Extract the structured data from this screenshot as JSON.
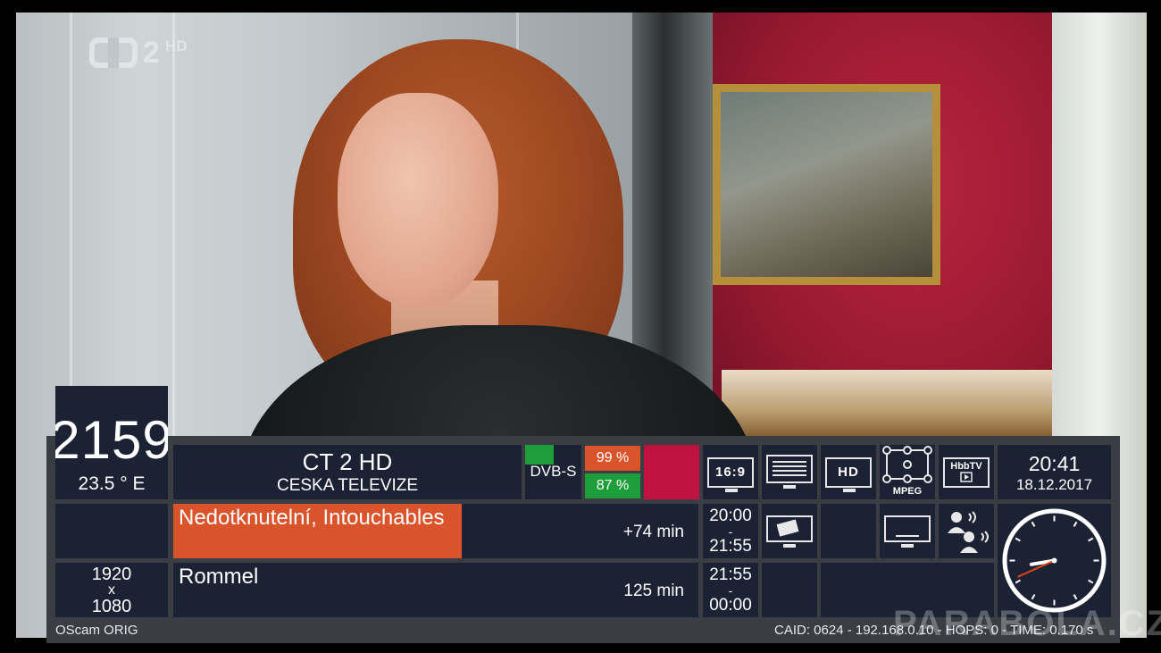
{
  "channel_logo": {
    "number": "2",
    "badge": "HD"
  },
  "satellite": {
    "transponder": "2159",
    "position": "23.5 ° E"
  },
  "channel": {
    "name": "CT 2 HD",
    "provider": "CESKA TELEVIZE"
  },
  "signal": {
    "system": "DVB-S",
    "quality": "99 %",
    "strength": "87 %",
    "quality_color": "#d9532b",
    "strength_color": "#1e9e3a",
    "alert_color": "#c0123f"
  },
  "flags": {
    "aspect": "16:9",
    "hd": "HD",
    "mpeg": "MPEG",
    "hbbtv": "HbbTV"
  },
  "clock": {
    "time": "20:41",
    "date": "18.12.2017",
    "hour": 20,
    "minute": 41
  },
  "programs": [
    {
      "title": "Nedotknutelní, Intouchables",
      "remaining": "+74 min",
      "start": "20:00",
      "sep": "-",
      "end": "21:55",
      "progress": 0.55
    },
    {
      "title": "Rommel",
      "remaining": "125 min",
      "start": "21:55",
      "sep": "-",
      "end": "00:00"
    }
  ],
  "resolution": {
    "width": "1920",
    "x": "x",
    "height": "1080"
  },
  "footer": {
    "cam": "OScam ORIG",
    "ecm": "CAID: 0624 - 192.168.0.10 - HOPS: 0 - TIME: 0.170 s"
  },
  "watermark": "PARABOLA.CZ",
  "accent_color": "#d9532b",
  "panel_color": "#1b2234"
}
